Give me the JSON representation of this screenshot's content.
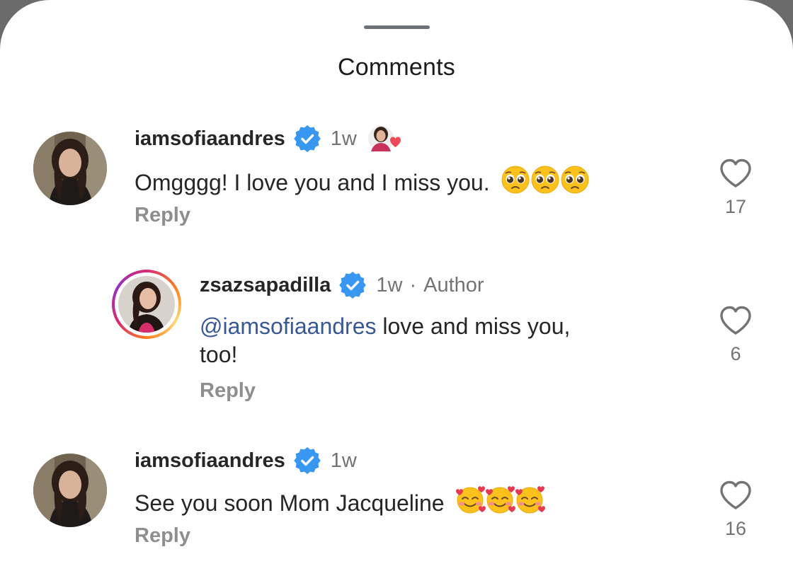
{
  "header": {
    "title": "Comments"
  },
  "comments": [
    {
      "username": "iamsofiaandres",
      "time": "1w",
      "text": "Omgggg! I love you and I miss you.",
      "emoji": "pleading-face-emoji",
      "emoji_count": 3,
      "reply_label": "Reply",
      "likes": "17",
      "liked_by_author": true
    },
    {
      "username": "zsazsapadilla",
      "time": "1w",
      "separator": "·",
      "badge": "Author",
      "mention": "@iamsofiaandres",
      "text_after_mention": " love and miss you,",
      "text_line2": "too!",
      "reply_label": "Reply",
      "likes": "6"
    },
    {
      "username": "iamsofiaandres",
      "time": "1w",
      "text": "See you soon Mom Jacqueline",
      "emoji": "smiling-face-with-hearts-emoji",
      "emoji_count": 3,
      "reply_label": "Reply",
      "likes": "16"
    }
  ],
  "colors": {
    "verified_blue": "#3897f0",
    "mention_blue": "#385898",
    "heart_red": "#ed4956",
    "muted_gray": "#737373"
  },
  "icons": {
    "verified": "verified-badge-icon",
    "like": "heart-outline-icon"
  }
}
